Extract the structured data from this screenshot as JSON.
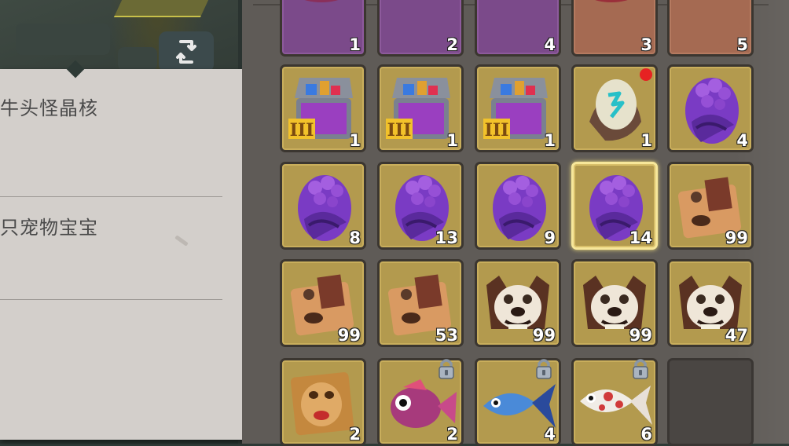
{
  "tooltip": {
    "lines": [
      "牛头怪晶核",
      "只宠物宝宝"
    ]
  },
  "swap_button": {
    "icon": "swap-arrows-icon"
  },
  "inventory": {
    "rows": [
      [
        {
          "icon": "purple-squid-creature-icon",
          "count": "1",
          "bg": "purple"
        },
        {
          "icon": "blue-fish-tail-icon",
          "count": "2",
          "bg": "purple"
        },
        {
          "icon": "white-koi-tail-icon",
          "count": "4",
          "bg": "purple"
        },
        {
          "icon": "red-squid-creature-icon",
          "count": "3",
          "bg": "brownish"
        },
        {
          "icon": "koi-tail-icon",
          "count": "5",
          "bg": "brownish"
        }
      ],
      [
        {
          "icon": "treasure-chest-tier3-icon",
          "count": "1",
          "bg": "gold"
        },
        {
          "icon": "treasure-chest-tier3-icon",
          "count": "1",
          "bg": "gold"
        },
        {
          "icon": "treasure-chest-tier3-icon",
          "count": "1",
          "bg": "gold"
        },
        {
          "icon": "rune-egg-icon",
          "count": "1",
          "bg": "gold",
          "badge": true
        },
        {
          "icon": "purple-egg-icon",
          "count": "4",
          "bg": "gold"
        }
      ],
      [
        {
          "icon": "purple-egg-icon",
          "count": "8",
          "bg": "gold"
        },
        {
          "icon": "purple-egg-icon",
          "count": "13",
          "bg": "gold"
        },
        {
          "icon": "purple-egg-icon",
          "count": "9",
          "bg": "gold"
        },
        {
          "icon": "purple-egg-icon",
          "count": "14",
          "bg": "gold",
          "selected": true
        },
        {
          "icon": "dog-crate-icon",
          "count": "99",
          "bg": "gold"
        }
      ],
      [
        {
          "icon": "dog-crate-icon",
          "count": "99",
          "bg": "gold"
        },
        {
          "icon": "dog-crate-icon",
          "count": "53",
          "bg": "gold"
        },
        {
          "icon": "bulldog-head-icon",
          "count": "99",
          "bg": "gold"
        },
        {
          "icon": "bulldog-head-icon",
          "count": "99",
          "bg": "gold"
        },
        {
          "icon": "bulldog-head-icon",
          "count": "47",
          "bg": "gold"
        }
      ],
      [
        {
          "icon": "pug-face-crate-icon",
          "count": "2",
          "bg": "gold"
        },
        {
          "icon": "pink-puffer-fish-icon",
          "count": "2",
          "bg": "gold",
          "locked": true
        },
        {
          "icon": "blue-fish-icon",
          "count": "4",
          "bg": "gold",
          "locked": true
        },
        {
          "icon": "white-koi-fish-icon",
          "count": "6",
          "bg": "gold",
          "locked": true
        },
        {
          "icon": "",
          "count": "",
          "bg": "empty"
        }
      ]
    ]
  },
  "colors": {
    "slot_gold": "#b39a4e",
    "slot_purple": "#7b4a8a",
    "selected_border": "#f7e79a",
    "badge_red": "#e62222",
    "panel": "#d3cfcb"
  }
}
